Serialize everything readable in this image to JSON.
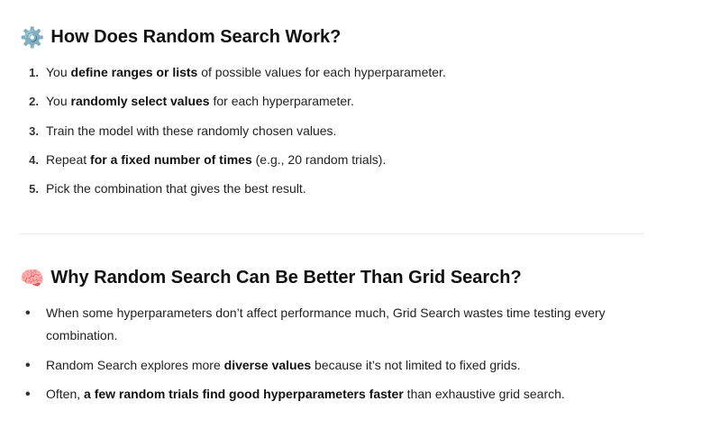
{
  "section1": {
    "icon": "gear-icon",
    "title": "How Does Random Search Work?",
    "steps": [
      {
        "marker": "1.",
        "pre": "You ",
        "bold": "define ranges or lists",
        "post": " of possible values for each hyperparameter."
      },
      {
        "marker": "2.",
        "pre": "You ",
        "bold": "randomly select values",
        "post": " for each hyperparameter."
      },
      {
        "marker": "3.",
        "pre": "Train the model with these randomly chosen values.",
        "bold": "",
        "post": ""
      },
      {
        "marker": "4.",
        "pre": "Repeat ",
        "bold": "for a fixed number of times",
        "post": " (e.g., 20 random trials)."
      },
      {
        "marker": "5.",
        "pre": "Pick the combination that gives the best result.",
        "bold": "",
        "post": ""
      }
    ]
  },
  "section2": {
    "icon": "brain-icon",
    "title": "Why Random Search Can Be Better Than Grid Search?",
    "bullets": [
      {
        "line1": "When some hyperparameters don’t affect performance much, Grid Search wastes time testing every",
        "line2": "combination."
      },
      {
        "pre": "Random Search explores more ",
        "bold": "diverse values",
        "post": " because it’s not limited to fixed grids."
      },
      {
        "pre": "Often, ",
        "bold": "a few random trials find good hyperparameters faster",
        "post": " than exhaustive grid search."
      }
    ]
  }
}
